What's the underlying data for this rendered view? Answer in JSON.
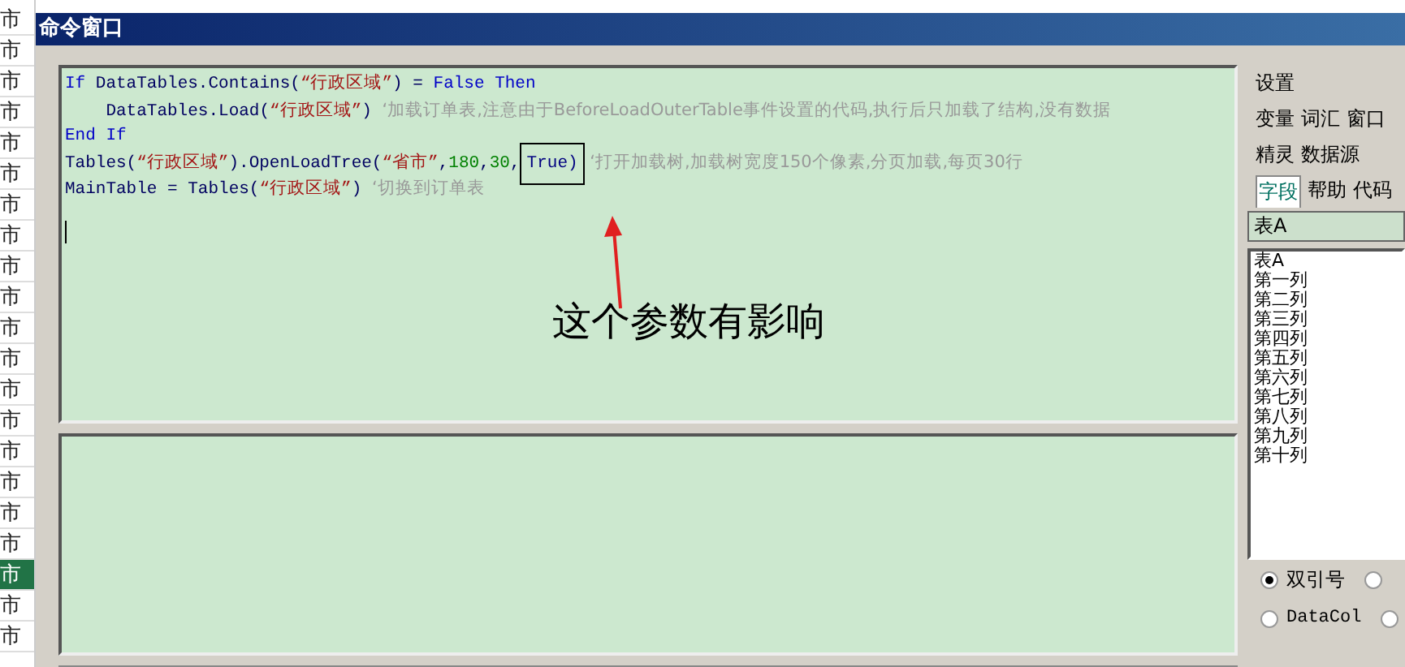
{
  "sheet_cells": [
    {
      "text": "市",
      "selected": false
    },
    {
      "text": "市",
      "selected": false
    },
    {
      "text": "市",
      "selected": false
    },
    {
      "text": "市",
      "selected": false
    },
    {
      "text": "市",
      "selected": false
    },
    {
      "text": "市",
      "selected": false
    },
    {
      "text": "市",
      "selected": false
    },
    {
      "text": "市",
      "selected": false
    },
    {
      "text": "市",
      "selected": false
    },
    {
      "text": "市",
      "selected": false
    },
    {
      "text": "市",
      "selected": false
    },
    {
      "text": "市",
      "selected": false
    },
    {
      "text": "市",
      "selected": false
    },
    {
      "text": "市",
      "selected": false
    },
    {
      "text": "市",
      "selected": false
    },
    {
      "text": "市",
      "selected": false
    },
    {
      "text": "市",
      "selected": false
    },
    {
      "text": "市",
      "selected": false
    },
    {
      "text": "市",
      "selected": true
    },
    {
      "text": "市",
      "selected": false
    },
    {
      "text": "市",
      "selected": false
    }
  ],
  "window": {
    "title": "命令窗口"
  },
  "code_lines": [
    [
      {
        "kind": "kw",
        "text": "If "
      },
      {
        "kind": "id",
        "text": "DataTables.Contains("
      },
      {
        "kind": "str",
        "text": "“行政区域”"
      },
      {
        "kind": "id",
        "text": ") = "
      },
      {
        "kind": "kw",
        "text": "False Then"
      }
    ],
    [
      {
        "kind": "id",
        "text": "    DataTables.Load("
      },
      {
        "kind": "str",
        "text": "“行政区域”"
      },
      {
        "kind": "id",
        "text": ") "
      },
      {
        "kind": "comment",
        "text": "‘加载订单表,注意由于BeforeLoadOuterTable事件设置的代码,执行后只加载了结构,没有数据"
      }
    ],
    [
      {
        "kind": "kw",
        "text": "End If"
      }
    ],
    [
      {
        "kind": "id",
        "text": "Tables("
      },
      {
        "kind": "str",
        "text": "“行政区域”"
      },
      {
        "kind": "id",
        "text": ").OpenLoadTree("
      },
      {
        "kind": "str",
        "text": "“省市”"
      },
      {
        "kind": "id",
        "text": ","
      },
      {
        "kind": "num",
        "text": "180"
      },
      {
        "kind": "id",
        "text": ","
      },
      {
        "kind": "num",
        "text": "30"
      },
      {
        "kind": "id",
        "text": ","
      },
      {
        "kind": "boxed",
        "text": "True)"
      },
      {
        "kind": "comment",
        "text": " ‘打开加载树,加载树宽度150个像素,分页加载,每页30行"
      }
    ],
    [
      {
        "kind": "id",
        "text": "MainTable = Tables("
      },
      {
        "kind": "str",
        "text": "“行政区域”"
      },
      {
        "kind": "id",
        "text": ") "
      },
      {
        "kind": "comment",
        "text": "‘切换到订单表"
      }
    ]
  ],
  "annotation": {
    "text": "这个参数有影响"
  },
  "side_panel": {
    "title": "设置",
    "tab_rows": [
      [
        {
          "label": "变量",
          "selected": false
        },
        {
          "label": "词汇",
          "selected": false
        },
        {
          "label": "窗口",
          "selected": false
        }
      ],
      [
        {
          "label": "精灵",
          "selected": false
        },
        {
          "label": "数据源",
          "selected": false
        }
      ],
      [
        {
          "label": "字段",
          "selected": true
        },
        {
          "label": "帮助",
          "selected": false
        },
        {
          "label": "代码",
          "selected": false
        }
      ]
    ],
    "table_select": "表A",
    "fields": [
      "表A",
      "第一列",
      "第二列",
      "第三列",
      "第四列",
      "第五列",
      "第六列",
      "第七列",
      "第八列",
      "第九列",
      "第十列"
    ],
    "radios": [
      {
        "label": "双引号",
        "selected": true
      },
      {
        "selected": false
      },
      {
        "label": "DataCol",
        "selected": false
      },
      {
        "selected": false
      }
    ]
  }
}
